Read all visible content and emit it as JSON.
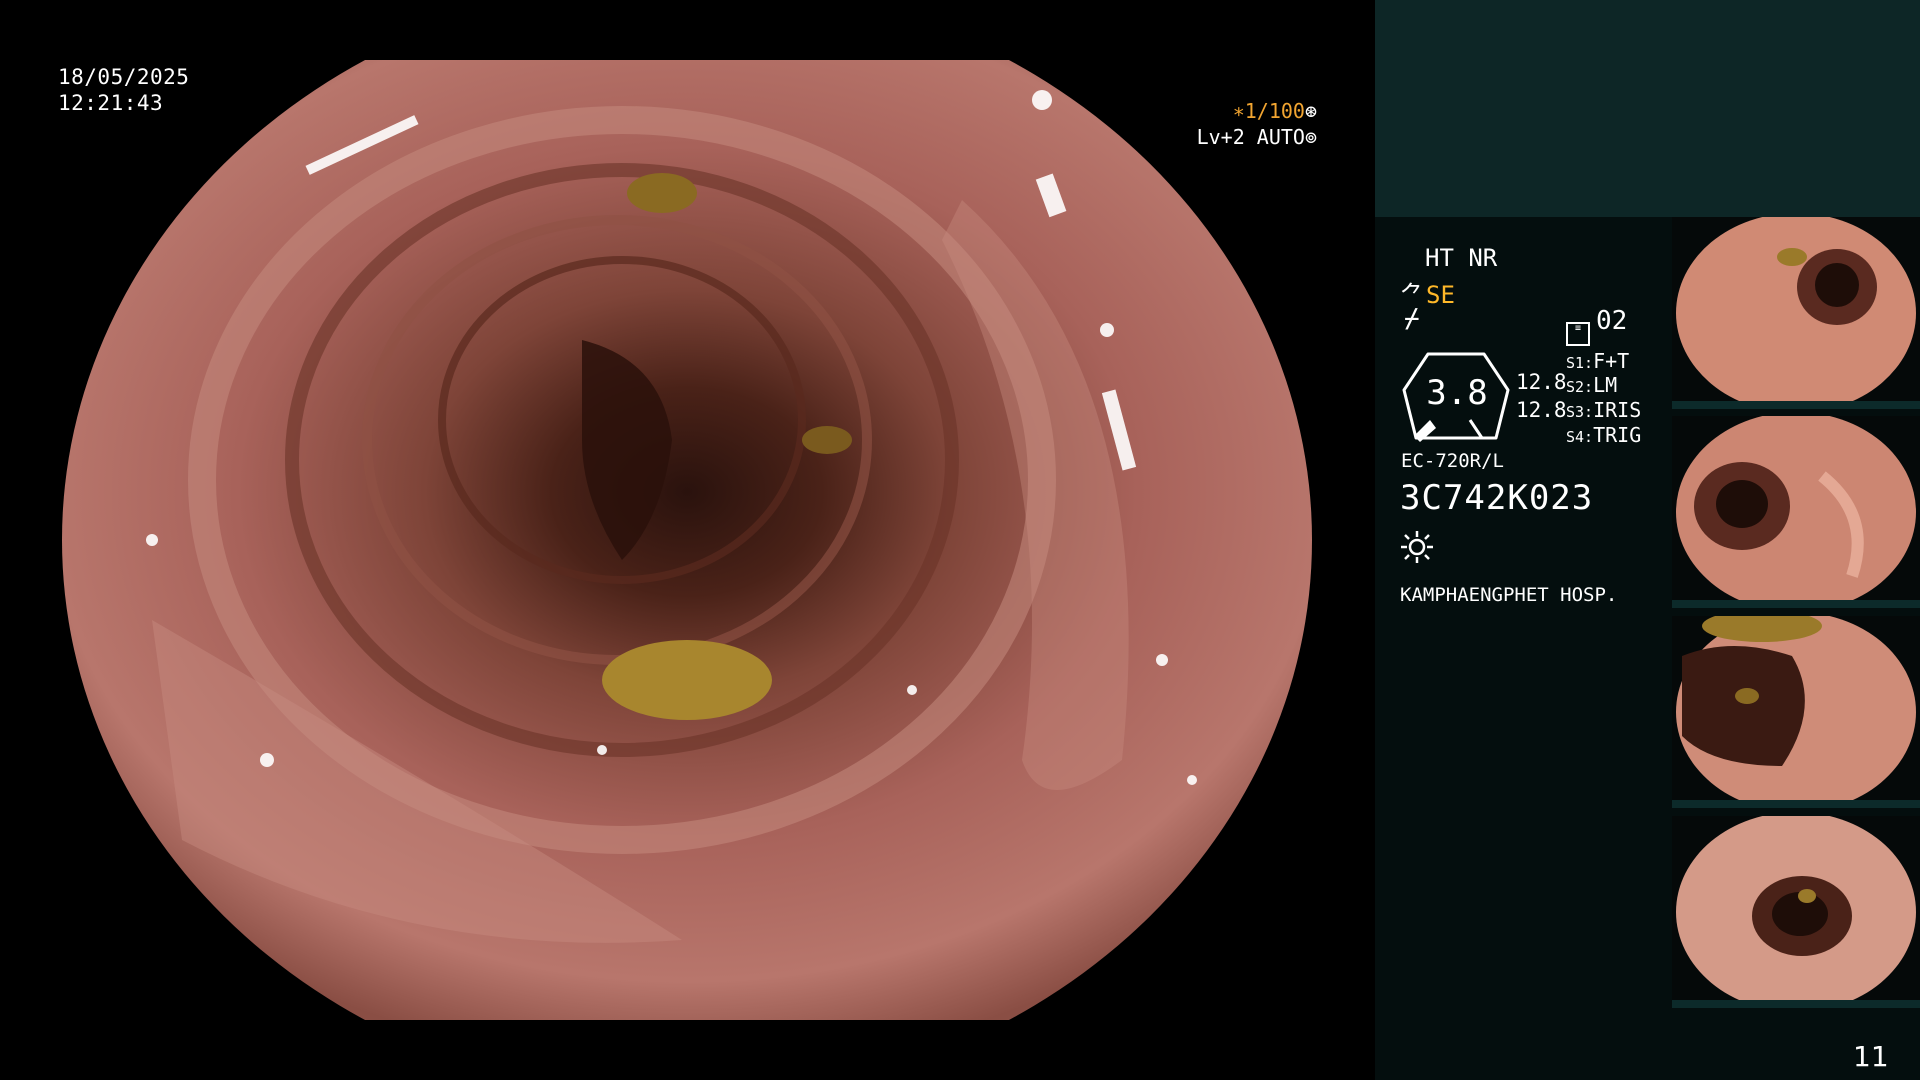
{
  "overlay": {
    "date": "18/05/2025",
    "time": "12:21:43",
    "shutter_speed": "∗1/100",
    "shutter_icon": "aperture-icon",
    "light_level": "Lv+2 AUTO",
    "light_icon": "iris-icon"
  },
  "panel": {
    "ht_nr": "HT NR",
    "enhance": "SE",
    "mode_code": "02",
    "gauge_value": "3.8",
    "value_a": "12.8",
    "value_b": "12.8",
    "s_settings": [
      {
        "key": "S1:",
        "value": "F+T"
      },
      {
        "key": "S2:",
        "value": "LM"
      },
      {
        "key": "S3:",
        "value": "IRIS"
      },
      {
        "key": "S4:",
        "value": "TRIG"
      }
    ],
    "scope_model": "EC-720R/L",
    "scope_serial": "3C742K023",
    "hospital": "KAMPHAENGPHET HOSP."
  },
  "thumbnails": [
    {
      "label": "capture-1"
    },
    {
      "label": "capture-2"
    },
    {
      "label": "capture-3"
    },
    {
      "label": "capture-4"
    }
  ],
  "footer": {
    "page_number": "11"
  },
  "colors": {
    "panel_top": "#0d2626",
    "panel_bottom": "#040e0e",
    "accent_orange": "#f2a531",
    "mucosa": "#a8625a"
  }
}
